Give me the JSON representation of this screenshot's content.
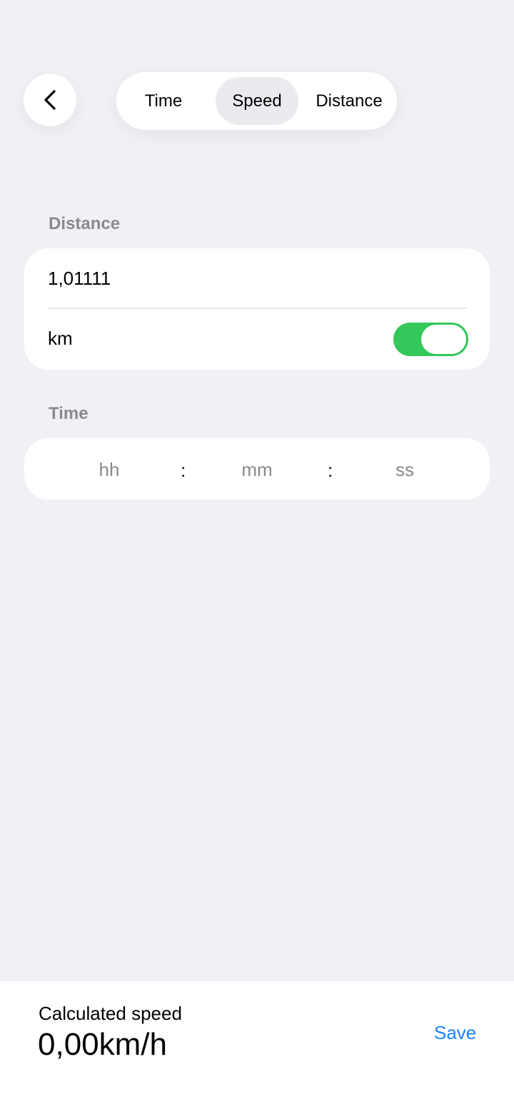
{
  "header": {
    "back_icon": "chevron-left-icon",
    "tabs": [
      {
        "label": "Time",
        "selected": false
      },
      {
        "label": "Speed",
        "selected": true
      },
      {
        "label": "Distance",
        "selected": false
      }
    ]
  },
  "distance_section": {
    "label": "Distance",
    "value": "1,01111",
    "unit_label": "km",
    "unit_toggle_on": true
  },
  "time_section": {
    "label": "Time",
    "hours_placeholder": "hh",
    "minutes_placeholder": "mm",
    "seconds_placeholder": "ss",
    "separator": ":"
  },
  "result": {
    "label": "Calculated speed",
    "value": "0,00km/h",
    "save_label": "Save"
  },
  "colors": {
    "accent": "#1a84ff",
    "toggle_on": "#34c75a",
    "background": "#f1f1f5"
  }
}
